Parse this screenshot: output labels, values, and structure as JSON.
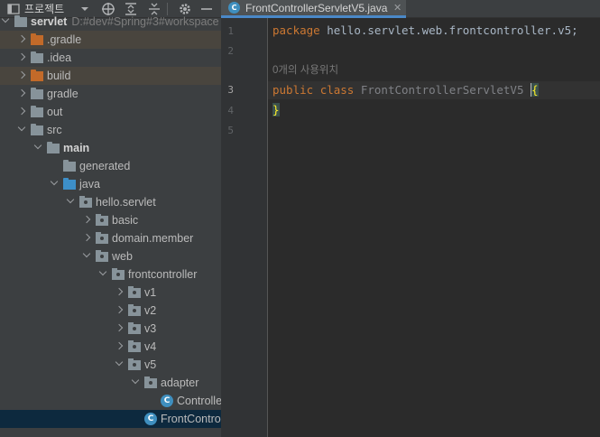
{
  "project_panel": {
    "title": "프로젝트",
    "toolbar_icons": [
      "dropdown-icon",
      "crosshair-icon",
      "expand-all-icon",
      "collapse-all-icon",
      "gear-icon",
      "minimize-icon"
    ]
  },
  "tree": [
    {
      "label": "servlet",
      "path": "D:#dev#Spring#3#workspace",
      "icon": "module-icon",
      "expanded": true
    },
    {
      "label": ".gradle",
      "icon": "folder-orange-icon",
      "expanded": false,
      "excluded": true
    },
    {
      "label": ".idea",
      "icon": "folder-icon",
      "expanded": false
    },
    {
      "label": "build",
      "icon": "folder-orange-icon",
      "expanded": false,
      "excluded": true
    },
    {
      "label": "gradle",
      "icon": "folder-icon",
      "expanded": false
    },
    {
      "label": "out",
      "icon": "folder-icon",
      "expanded": false
    },
    {
      "label": "src",
      "icon": "folder-icon",
      "expanded": true
    },
    {
      "label": "main",
      "icon": "module-folder-icon",
      "expanded": true
    },
    {
      "label": "generated",
      "icon": "folder-icon"
    },
    {
      "label": "java",
      "icon": "source-folder-icon",
      "expanded": true
    },
    {
      "label": "hello.servlet",
      "icon": "package-icon",
      "expanded": true
    },
    {
      "label": "basic",
      "icon": "package-icon",
      "expanded": false
    },
    {
      "label": "domain.member",
      "icon": "package-icon",
      "expanded": false
    },
    {
      "label": "web",
      "icon": "package-icon",
      "expanded": true
    },
    {
      "label": "frontcontroller",
      "icon": "package-icon",
      "expanded": true
    },
    {
      "label": "v1",
      "icon": "package-icon",
      "expanded": false
    },
    {
      "label": "v2",
      "icon": "package-icon",
      "expanded": false
    },
    {
      "label": "v3",
      "icon": "package-icon",
      "expanded": false
    },
    {
      "label": "v4",
      "icon": "package-icon",
      "expanded": false
    },
    {
      "label": "v5",
      "icon": "package-icon",
      "expanded": true
    },
    {
      "label": "adapter",
      "icon": "package-icon",
      "expanded": true
    },
    {
      "label": "Controlle",
      "icon": "class-icon"
    },
    {
      "label": "FrontControl",
      "icon": "class-icon",
      "selected": true
    }
  ],
  "editor": {
    "tab": {
      "title": "FrontControllerServletV5.java",
      "icon": "class-icon",
      "close": "✕"
    },
    "line_numbers": [
      "1",
      "2",
      "3",
      "4",
      "5"
    ],
    "code": {
      "line1_kw": "package",
      "line1_rest": " hello.servlet.web.frontcontroller.v5;",
      "usages_hint": "0개의 사용위치",
      "line3_kw1": "public",
      "line3_kw2": "class",
      "line3_name": "FrontControllerServletV5",
      "line3_brace": "{",
      "line4_brace": "}"
    }
  },
  "colors": {
    "keyword": "#cc7832",
    "identifier": "#a9b7c6",
    "excluded_folder": "#c26a29",
    "source_folder": "#3d8fc8",
    "selection": "#0d293e"
  }
}
